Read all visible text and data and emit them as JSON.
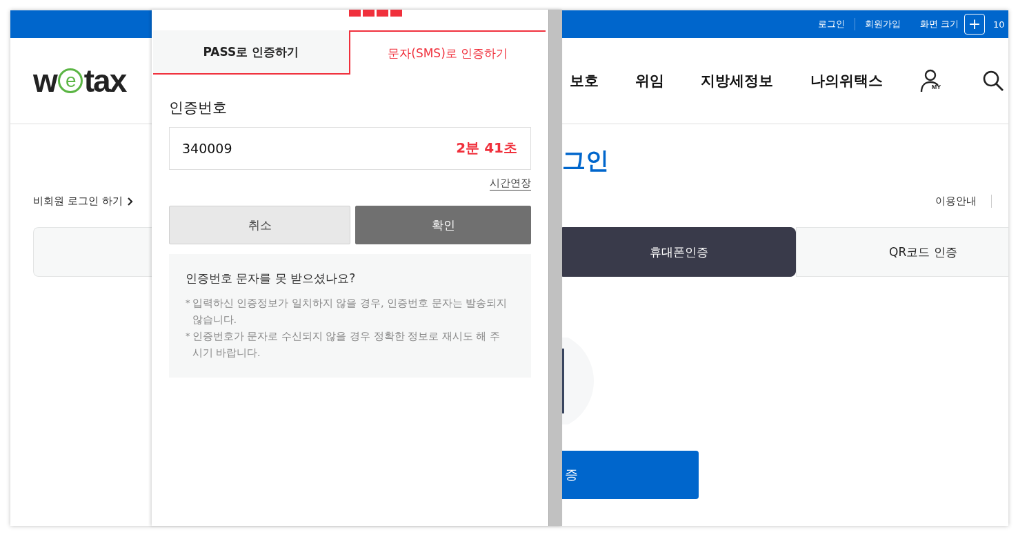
{
  "top_bar": {
    "links": [
      "로그인",
      "회원가입"
    ],
    "font_size_label": "화면 크기",
    "plus_key": "+",
    "zoom_value": "10"
  },
  "header": {
    "logo": {
      "before": "w",
      "circled": "e",
      "after": "tax"
    },
    "nav": [
      "보호",
      "위임",
      "지방세정보",
      "나의위택스"
    ],
    "my_label": "MY"
  },
  "page_title": "그인",
  "nonmember_link": "비회원 로그인 하기",
  "guide_link": "이용안내",
  "auth_tabs": [
    {
      "selected": false
    },
    {
      "label": "휴대폰인증",
      "selected": true
    },
    {
      "label": "QR코드 인증",
      "selected": false
    }
  ],
  "action_button": "증",
  "popup": {
    "tabs": [
      {
        "label": "PASS로 인증하기",
        "selected": false
      },
      {
        "label": "문자(SMS)로 인증하기",
        "selected": true
      }
    ],
    "field_label": "인증번호",
    "code_value": "340009",
    "timer": "2분 41초",
    "extend_link": "시간연장",
    "buttons": [
      {
        "label": "취소",
        "kind": "cancel"
      },
      {
        "label": "확인",
        "kind": "confirm"
      }
    ],
    "help": {
      "title": "인증번호 문자를 못 받으셨나요?",
      "notes": [
        {
          "marker": "*",
          "text": "입력하신 인증정보가 일치하지 않을 경우, 인증번호 문자는 발송되지 않습니다."
        },
        {
          "marker": "*",
          "text": "인증번호가 문자로 수신되지 않을 경우 정확한 정보로 재시도 해 주시기 바랍니다."
        }
      ]
    }
  }
}
